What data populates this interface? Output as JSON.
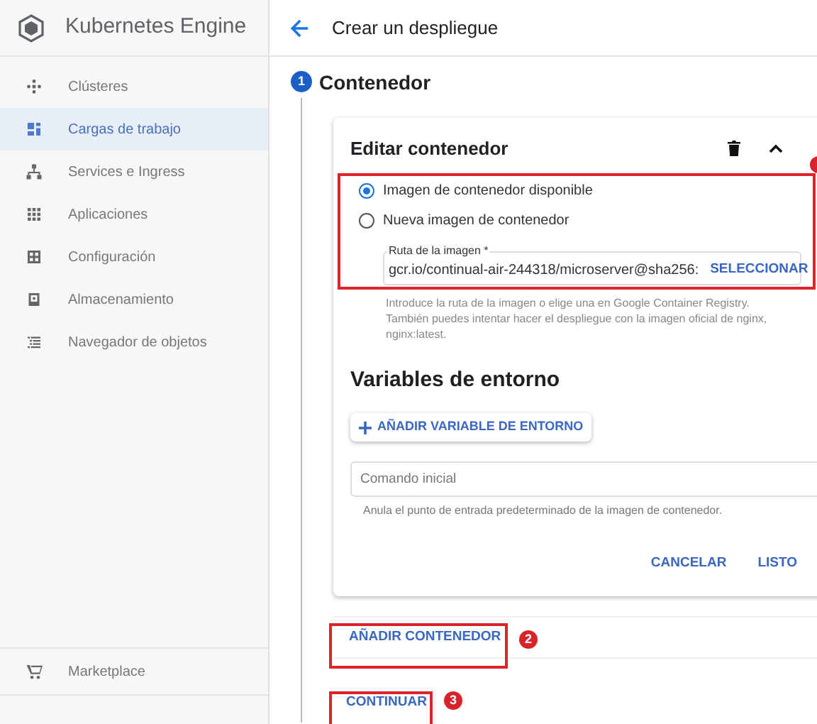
{
  "product": {
    "title": "Kubernetes Engine"
  },
  "sidebar": {
    "items": [
      {
        "label": "Clústeres",
        "selected": false
      },
      {
        "label": "Cargas de trabajo",
        "selected": true
      },
      {
        "label": "Services e Ingress",
        "selected": false
      },
      {
        "label": "Aplicaciones",
        "selected": false
      },
      {
        "label": "Configuración",
        "selected": false
      },
      {
        "label": "Almacenamiento",
        "selected": false
      },
      {
        "label": "Navegador de objetos",
        "selected": false
      }
    ],
    "footer": {
      "label": "Marketplace"
    }
  },
  "page": {
    "title": "Crear un despliegue"
  },
  "step": {
    "number": "1",
    "title": "Contenedor"
  },
  "card": {
    "title": "Editar contenedor",
    "radios": [
      {
        "label": "Imagen de contenedor disponible",
        "selected": true
      },
      {
        "label": "Nueva imagen de contenedor",
        "selected": false
      }
    ],
    "image_field": {
      "label": "Ruta de la imagen *",
      "value": "gcr.io/continual-air-244318/microserver@sha256:",
      "action": "SELECCIONAR"
    },
    "image_help": "Introduce la ruta de la imagen o elige una en Google Container Registry. También puedes intentar hacer el despliegue con la imagen oficial de nginx, nginx:latest.",
    "env_title": "Variables de entorno",
    "add_env": "AÑADIR VARIABLE DE ENTORNO",
    "command_field": {
      "placeholder": "Comando inicial"
    },
    "command_help": "Anula el punto de entrada predeterminado de la imagen de contenedor.",
    "buttons": [
      "CANCELAR",
      "LISTO"
    ]
  },
  "add_container": "AÑADIR CONTENEDOR",
  "continue": "CONTINUAR",
  "annotations": [
    {
      "label": "2"
    },
    {
      "label": "3"
    }
  ]
}
